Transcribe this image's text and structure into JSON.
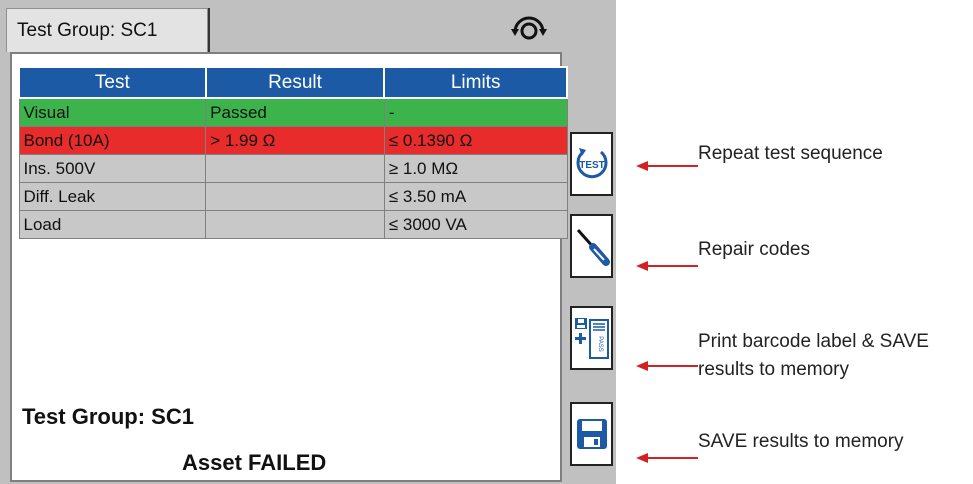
{
  "tab": {
    "label": "Test Group: SC1"
  },
  "table": {
    "headers": [
      "Test",
      "Result",
      "Limits"
    ],
    "rows": [
      {
        "test": "Visual",
        "result": "Passed",
        "limit": "-",
        "status": "pass"
      },
      {
        "test": "Bond (10A)",
        "result": "> 1.99 Ω",
        "limit": "≤ 0.1390 Ω",
        "status": "fail"
      },
      {
        "test": "Ins. 500V",
        "result": "",
        "limit": "≥ 1.0 MΩ",
        "status": "none"
      },
      {
        "test": "Diff. Leak",
        "result": "",
        "limit": "≤ 3.50 mA",
        "status": "none"
      },
      {
        "test": "Load",
        "result": "",
        "limit": "≤ 3000 VA",
        "status": "none"
      }
    ]
  },
  "status": {
    "group": "Test Group: SC1",
    "asset": "Asset FAILED"
  },
  "buttons": {
    "repeat_icon_text": "TEST",
    "print_icon_text": "PASS"
  },
  "callouts": {
    "repeat": "Repeat test sequence",
    "repair": "Repair codes",
    "print_line1": "Print barcode label & SAVE",
    "print_line2": "results to memory",
    "save": "SAVE results to memory"
  },
  "colors": {
    "header_bg": "#1c5aa5",
    "pass": "#3cb44b",
    "fail": "#e82b2b",
    "neutral": "#c8c8c8",
    "button_blue": "#1c5aa5",
    "arrow": "#d42020"
  },
  "icons": [
    "rotate-icon",
    "repeat-test-icon",
    "screwdriver-icon",
    "print-barcode-icon",
    "save-disk-icon"
  ]
}
